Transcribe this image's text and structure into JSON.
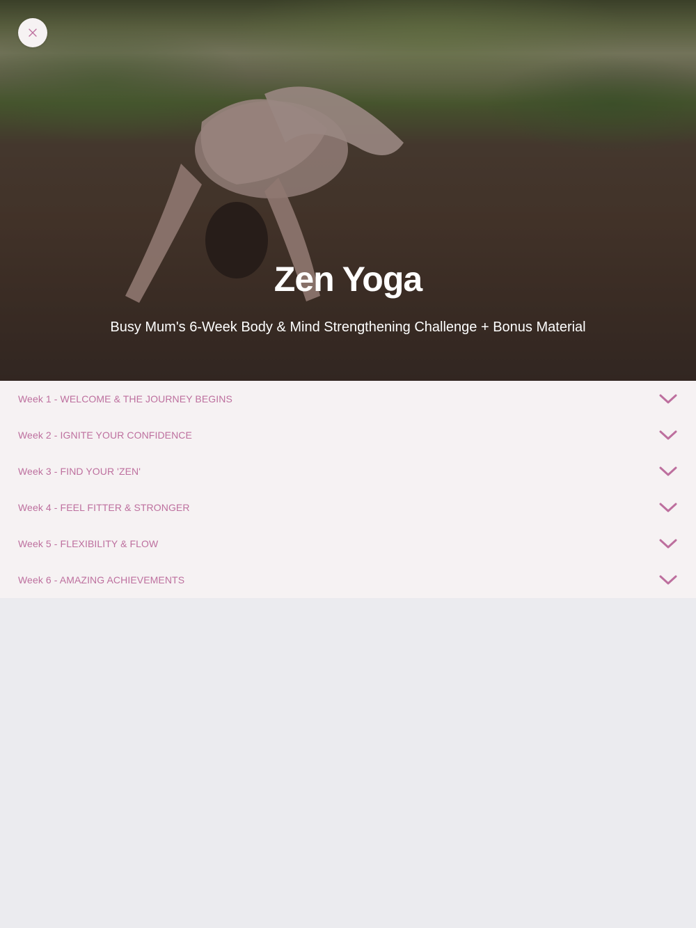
{
  "hero": {
    "title": "Zen Yoga",
    "subtitle": "Busy Mum's 6-Week Body & Mind Strengthening Challenge + Bonus Material",
    "close_icon": "close-icon"
  },
  "weeks": [
    {
      "label": "Week 1 - WELCOME & THE JOURNEY BEGINS",
      "icon": "chevron-down-icon"
    },
    {
      "label": "Week 2 - IGNITE YOUR CONFIDENCE",
      "icon": "chevron-down-icon"
    },
    {
      "label": "Week 3 - FIND YOUR 'ZEN'",
      "icon": "chevron-down-icon"
    },
    {
      "label": "Week 4 - FEEL FITTER & STRONGER",
      "icon": "chevron-down-icon"
    },
    {
      "label": "Week 5 - FLEXIBILITY & FLOW",
      "icon": "chevron-down-icon"
    },
    {
      "label": "Week 6 - AMAZING ACHIEVEMENTS",
      "icon": "chevron-down-icon"
    }
  ],
  "colors": {
    "accent": "#bd6f9e",
    "list_background": "#f6f2f3",
    "page_background": "#ebebef"
  }
}
